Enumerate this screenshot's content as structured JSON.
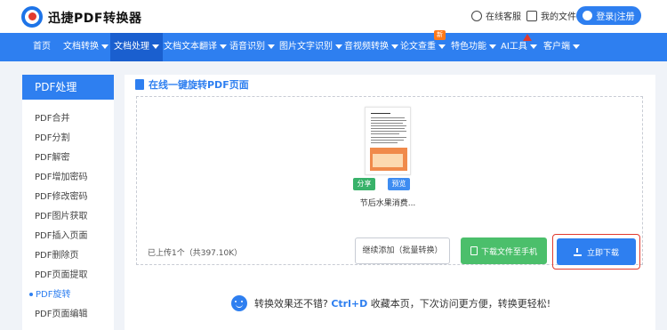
{
  "header": {
    "brand": "迅捷PDF转换器",
    "service_label": "在线客服",
    "myfiles_label": "我的文件",
    "login_label": "登录|注册"
  },
  "nav": {
    "items": [
      {
        "label": "首页",
        "caret": false
      },
      {
        "label": "文档转换",
        "caret": true
      },
      {
        "label": "文档处理",
        "caret": true,
        "active": true
      },
      {
        "label": "文档文本翻译",
        "caret": true
      },
      {
        "label": "语音识别",
        "caret": true
      },
      {
        "label": "图片文字识别",
        "caret": true
      },
      {
        "label": "音视频转换",
        "caret": true
      },
      {
        "label": "论文查重",
        "caret": true,
        "badge": "新"
      },
      {
        "label": "特色功能",
        "caret": true
      },
      {
        "label": "AI工具",
        "caret": true
      },
      {
        "label": "客户端",
        "caret": true
      }
    ]
  },
  "sidebar": {
    "title": "PDF处理",
    "items": [
      {
        "label": "PDF合并"
      },
      {
        "label": "PDF分割"
      },
      {
        "label": "PDF解密"
      },
      {
        "label": "PDF增加密码"
      },
      {
        "label": "PDF修改密码"
      },
      {
        "label": "PDF图片获取"
      },
      {
        "label": "PDF插入页面"
      },
      {
        "label": "PDF删除页"
      },
      {
        "label": "PDF页面提取"
      },
      {
        "label": "PDF旋转",
        "active": true
      },
      {
        "label": "PDF页面编辑"
      }
    ]
  },
  "main": {
    "title": "在线一键旋转PDF页面",
    "file": {
      "name": "节后水果消费...",
      "share_label": "分享",
      "preview_label": "预览"
    },
    "uploaded_text": "已上传1个（共397.10K）",
    "continue_label": "继续添加（批量转换）",
    "phone_label": "下载文件至手机",
    "download_label": "立即下载"
  },
  "tip": {
    "prefix": "转换效果还不错?",
    "shortcut": "Ctrl+D",
    "suffix": "收藏本页，下次访问更方便，转换更轻松!"
  },
  "colors": {
    "primary": "#2e7ff0",
    "active_nav": "#1a5fcf",
    "green": "#4bbf6b",
    "highlight_border": "#e23a2e",
    "badge_new": "#ff7a1a"
  }
}
